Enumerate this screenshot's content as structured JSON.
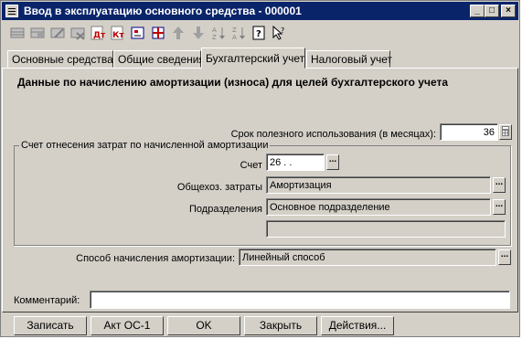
{
  "window": {
    "title": "Ввод в эксплуатацию основного средства - 000001"
  },
  "toolbar": {
    "icons": [
      "add-row-icon",
      "copy-row-icon",
      "edit-row-icon",
      "delete-row-icon",
      "dt-icon",
      "kt-icon",
      "set-parent-icon",
      "edit-in-dialog-icon",
      "move-up-icon",
      "move-down-icon",
      "sort-asc-icon",
      "sort-desc-icon",
      "help-icon",
      "whats-this-icon"
    ]
  },
  "tabs": [
    {
      "label": "Основные средства"
    },
    {
      "label": "Общие сведения"
    },
    {
      "label": "Бухгалтерский учет"
    },
    {
      "label": "Налоговый учет"
    }
  ],
  "active_tab": 2,
  "panel": {
    "heading": "Данные по начислению амортизации (износа) для целей бухгалтерского учета",
    "useful_life_label": "Срок полезного использования (в месяцах):",
    "useful_life_value": "36",
    "group_title": "Счет отнесения затрат по начисленной амортизации",
    "account_label": "Счет",
    "account_value": "26 . .",
    "expense_label": "Общехоз. затраты",
    "expense_value": "Амортизация",
    "division_label": "Подразделения",
    "division_value": "Основное подразделение",
    "extra_value": "",
    "method_label": "Способ начисления амортизации:",
    "method_value": "Линейный способ"
  },
  "comment": {
    "label": "Комментарий:",
    "value": ""
  },
  "buttons": {
    "save": "Записать",
    "act": "Акт ОС-1",
    "ok": "OK",
    "close": "Закрыть",
    "actions": "Действия..."
  }
}
